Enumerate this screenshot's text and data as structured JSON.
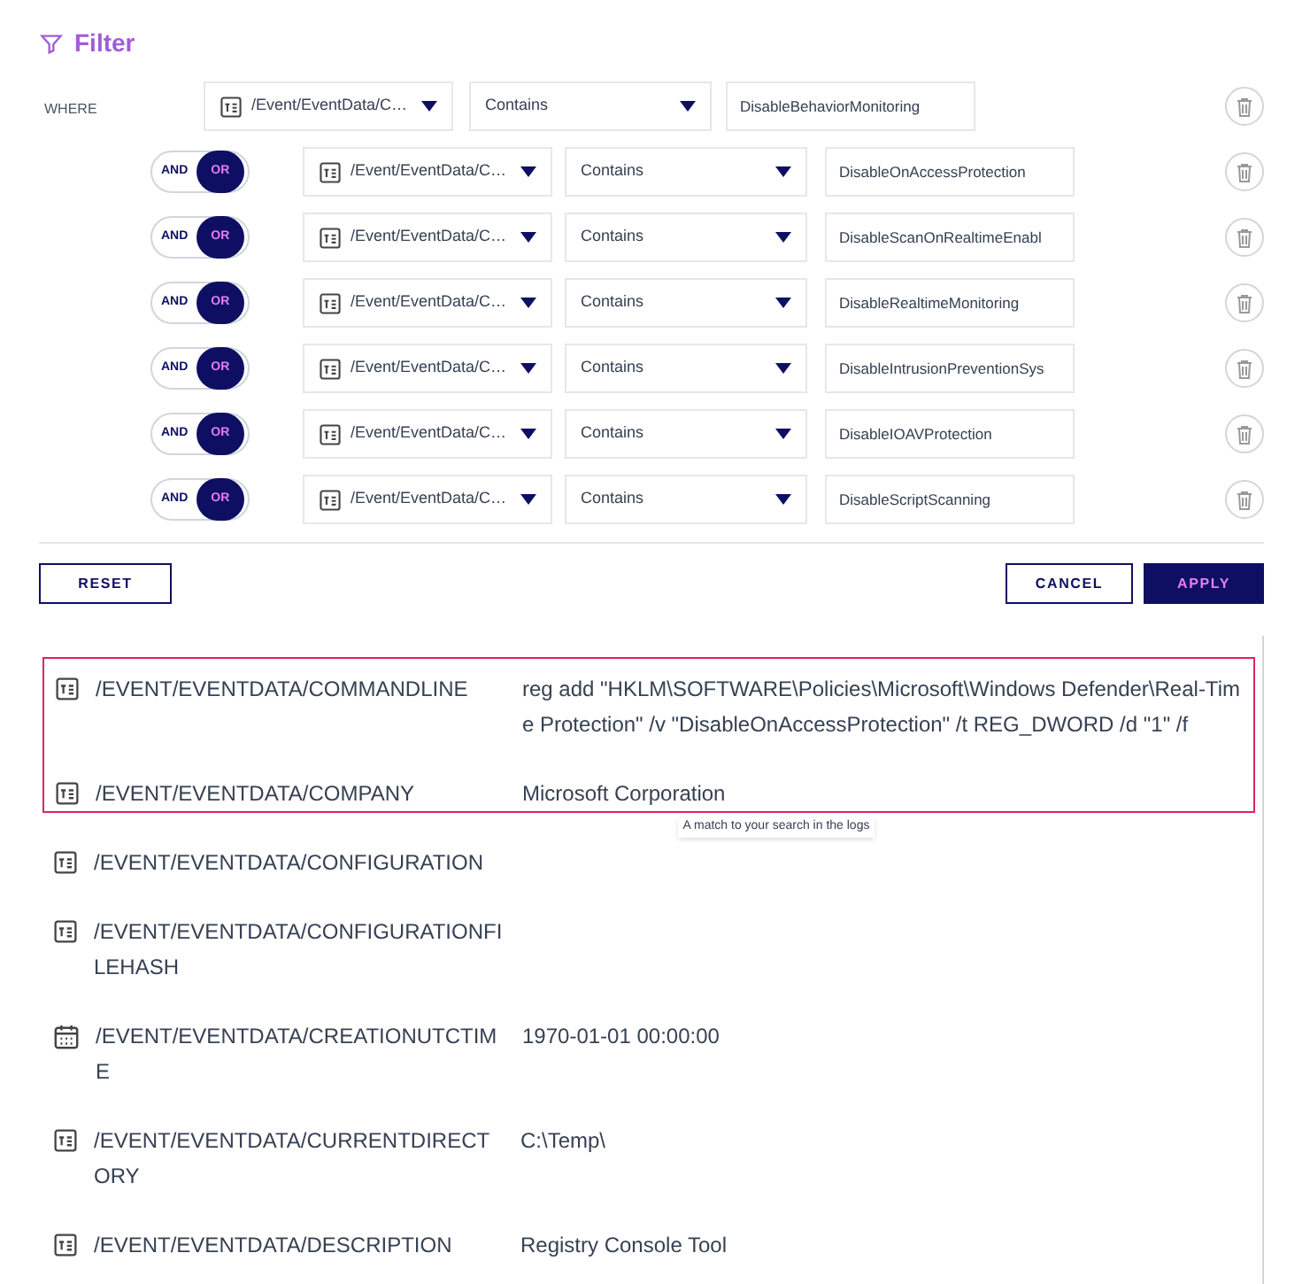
{
  "filter": {
    "title": "Filter",
    "where_label": "WHERE",
    "conditions": [
      {
        "field": "/Event/EventData/C…",
        "operator": "Contains",
        "value": "DisableBehaviorMonitoring"
      },
      {
        "logic": [
          {
            "label": "AND",
            "selected": false
          },
          {
            "label": "OR",
            "selected": true
          }
        ],
        "field": "/Event/EventData/C…",
        "operator": "Contains",
        "value": "DisableOnAccessProtection"
      },
      {
        "logic": [
          {
            "label": "AND",
            "selected": false
          },
          {
            "label": "OR",
            "selected": true
          }
        ],
        "field": "/Event/EventData/C…",
        "operator": "Contains",
        "value": "DisableScanOnRealtimeEnabl"
      },
      {
        "logic": [
          {
            "label": "AND",
            "selected": false
          },
          {
            "label": "OR",
            "selected": true
          }
        ],
        "field": "/Event/EventData/C…",
        "operator": "Contains",
        "value": "DisableRealtimeMonitoring"
      },
      {
        "logic": [
          {
            "label": "AND",
            "selected": false
          },
          {
            "label": "OR",
            "selected": true
          }
        ],
        "field": "/Event/EventData/C…",
        "operator": "Contains",
        "value": "DisableIntrusionPreventionSys"
      },
      {
        "logic": [
          {
            "label": "AND",
            "selected": false
          },
          {
            "label": "OR",
            "selected": true
          }
        ],
        "field": "/Event/EventData/C…",
        "operator": "Contains",
        "value": "DisableIOAVProtection"
      },
      {
        "logic": [
          {
            "label": "AND",
            "selected": false
          },
          {
            "label": "OR",
            "selected": true
          }
        ],
        "field": "/Event/EventData/C…",
        "operator": "Contains",
        "value": "DisableScriptScanning"
      }
    ],
    "buttons": {
      "reset": "RESET",
      "cancel": "CANCEL",
      "apply": "APPLY"
    }
  },
  "log": {
    "match": {
      "tooltip": "A match to your search in the logs",
      "entries": [
        {
          "kind": "text",
          "name": "/EVENT/EVENTDATA/COMMANDLINE",
          "value": "reg add \"HKLM\\SOFTWARE\\Policies\\Microsoft\\Windows Defender\\Real-Time Protection\" /v \"DisableOnAccessProtection\" /t REG_DWORD /d \"1\" /f"
        },
        {
          "kind": "text",
          "name": "/EVENT/EVENTDATA/COMPANY",
          "value": "Microsoft Corporation"
        }
      ]
    },
    "entries": [
      {
        "kind": "text",
        "name": "/EVENT/EVENTDATA/CONFIGURATION"
      },
      {
        "kind": "text",
        "name": "/EVENT/EVENTDATA/CONFIGURATIONFILEHASH"
      },
      {
        "kind": "date",
        "name": "/EVENT/EVENTDATA/CREATIONUTCTIME",
        "value": "1970-01-01 00:00:00"
      },
      {
        "kind": "text",
        "name": "/EVENT/EVENTDATA/CURRENTDIRECTORY",
        "value": "C:\\Temp\\"
      },
      {
        "kind": "text",
        "name": "/EVENT/EVENTDATA/DESCRIPTION",
        "value": "Registry Console Tool"
      }
    ]
  }
}
